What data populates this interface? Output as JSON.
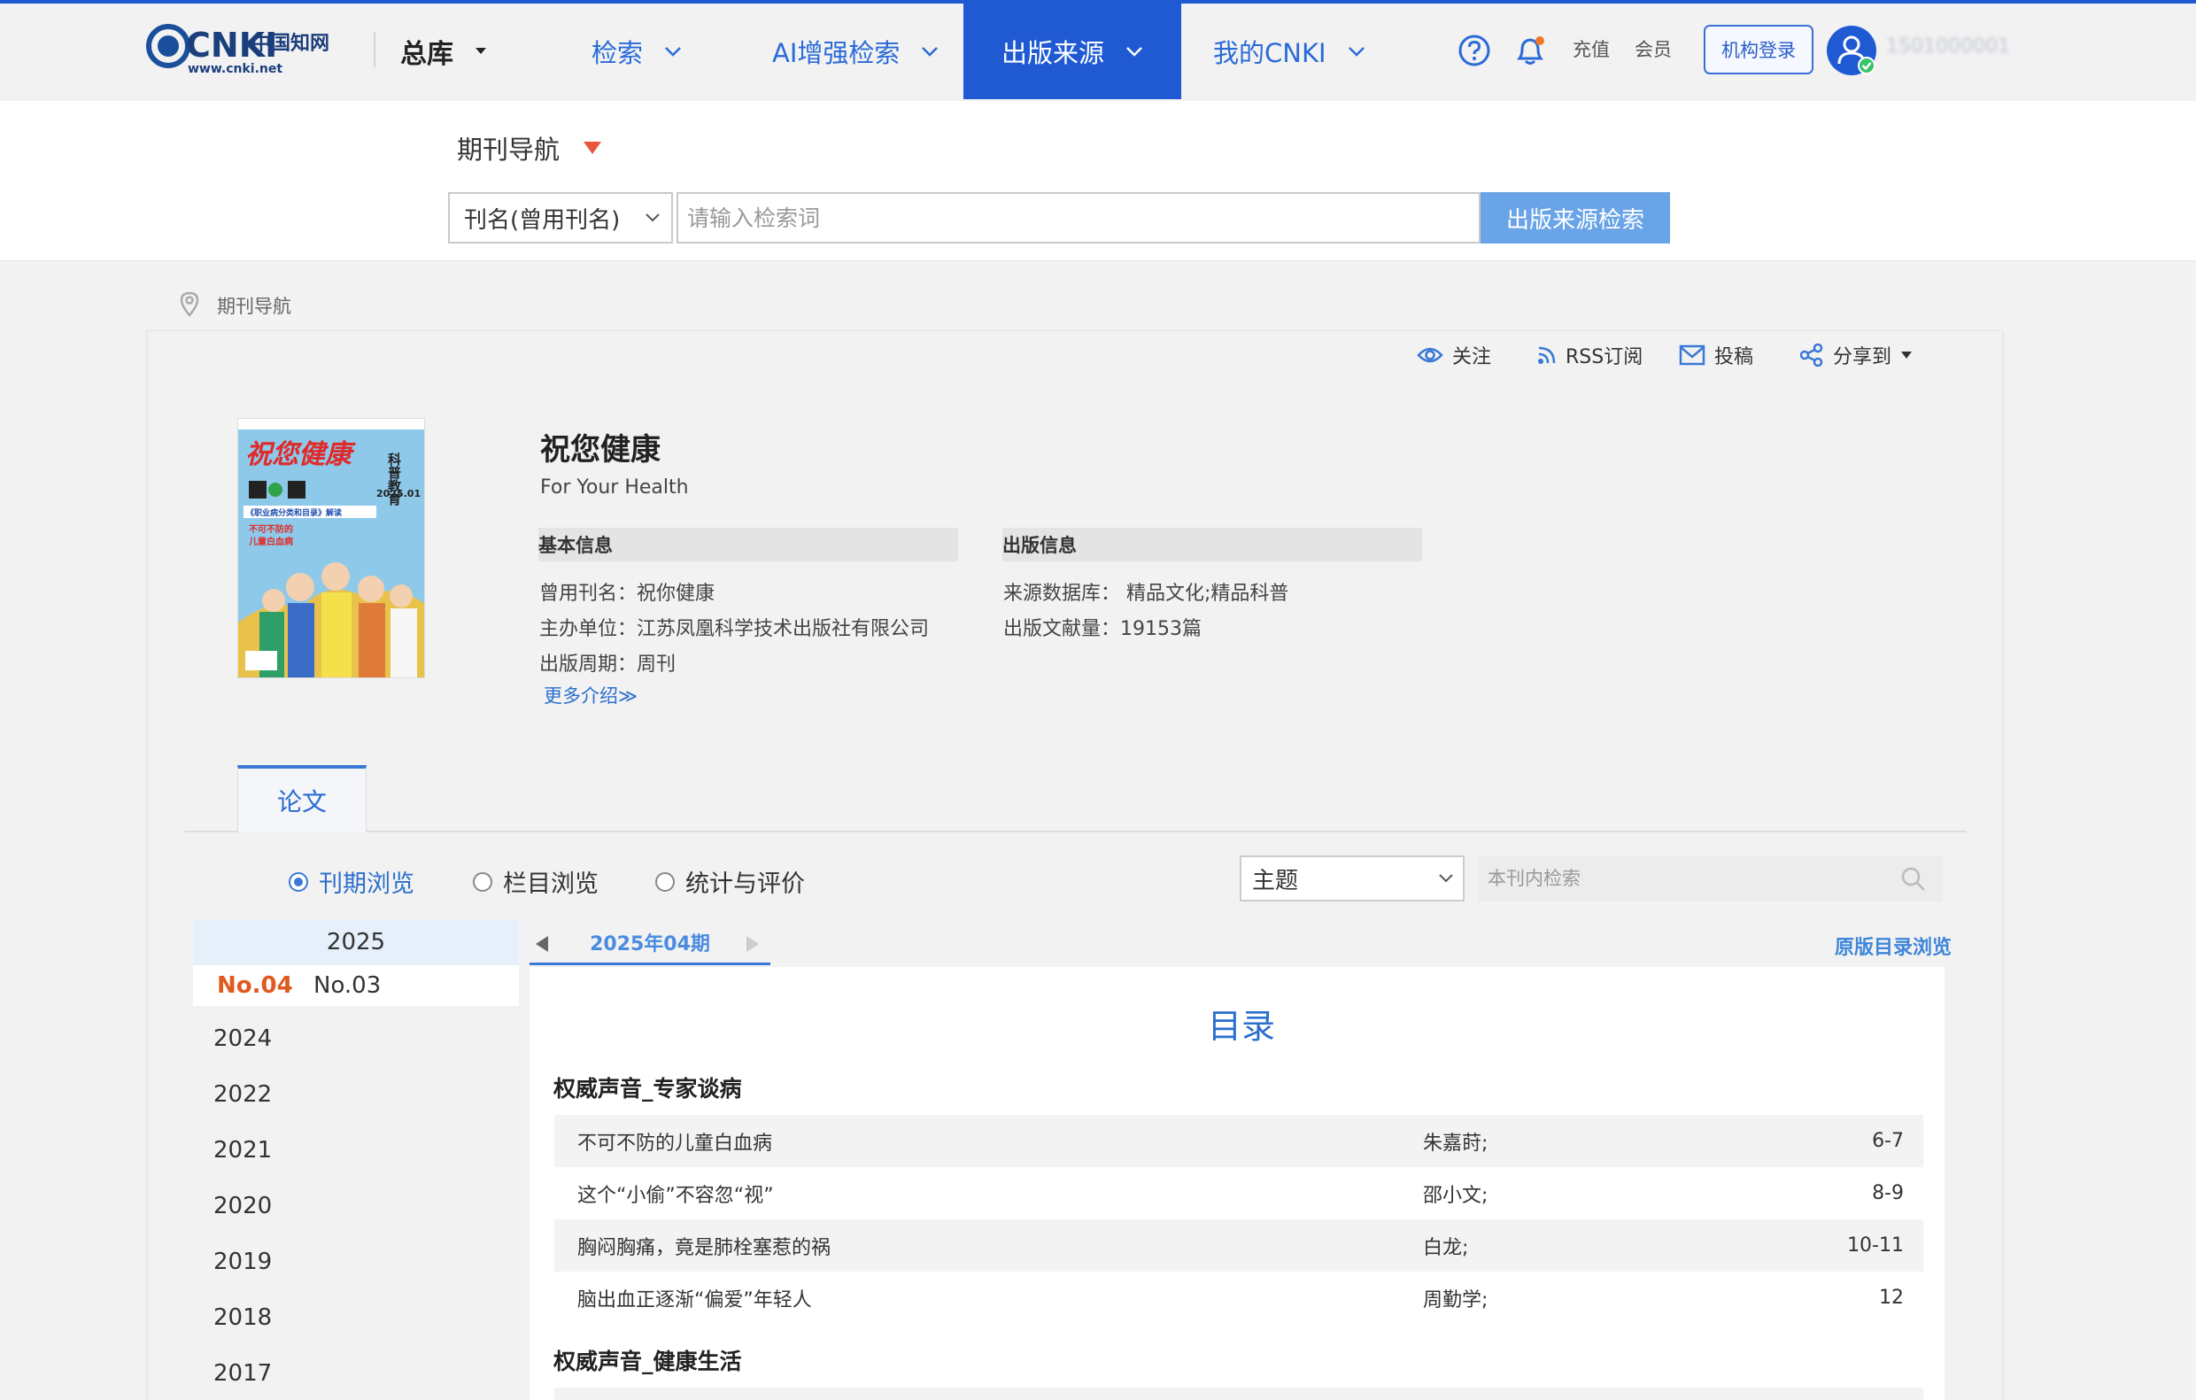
{
  "nav": {
    "zongku": "总库",
    "search": "检索",
    "ai_search": "AI增强检索",
    "pub_source": "出版来源",
    "my_cnki": "我的CNKI",
    "topup": "充值",
    "member": "会员",
    "inst_login": "机构登录",
    "user_name": "1501000001"
  },
  "logo": {
    "main": "CNKI",
    "cn": "中国知网",
    "url": "www.cnki.net"
  },
  "search": {
    "nav_label": "期刊导航",
    "field": "刊名(曾用刊名)",
    "placeholder": "请输入检索词",
    "button": "出版来源检索"
  },
  "breadcrumb": "期刊导航",
  "actions": {
    "follow": "关注",
    "rss": "RSS订阅",
    "submit": "投稿",
    "share": "分享到"
  },
  "cover": {
    "title": "祝您健康",
    "side": "科普教育",
    "issue": "2025.01",
    "line1": "《职业病分类和目录》解读",
    "line2": "不可不防的",
    "line3": "儿童白血病"
  },
  "journal": {
    "title": "祝您健康",
    "en_title": "For Your Health",
    "basic_head": "基本信息",
    "pub_head": "出版信息",
    "former_name": "曾用刊名：祝你健康",
    "sponsor": "主办单位：江苏凤凰科学技术出版社有限公司",
    "cycle": "出版周期：周刊",
    "more": "更多介绍≫",
    "source_db": "来源数据库：  精品文化;精品科普",
    "doc_count": "出版文献量：19153篇"
  },
  "tabs": {
    "papers": "论文"
  },
  "browse": {
    "mode_issue": "刊期浏览",
    "mode_column": "栏目浏览",
    "mode_stats": "统计与评价",
    "scope": "主题",
    "inner_placeholder": "本刊内检索"
  },
  "years": {
    "selected": "2025",
    "issue_current": "No.04",
    "issue_other": "No.03",
    "list": [
      "2024",
      "2022",
      "2021",
      "2020",
      "2019",
      "2018",
      "2017"
    ]
  },
  "issue": {
    "tab": "2025年04期",
    "orig_toc": "原版目录浏览"
  },
  "toc": {
    "title": "目录",
    "col1": "权威声音_专家谈病",
    "col2": "权威声音_健康生活",
    "rows": [
      {
        "title": "不可不防的儿童白血病",
        "author": "朱嘉莳;",
        "pages": "6-7"
      },
      {
        "title": "这个“小偷”不容忽“视”",
        "author": "邵小文;",
        "pages": "8-9"
      },
      {
        "title": "胸闷胸痛，竟是肺栓塞惹的祸",
        "author": "白龙;",
        "pages": "10-11"
      },
      {
        "title": "脑出血正逐渐“偏爱”年轻人",
        "author": "周勤学;",
        "pages": "12"
      }
    ]
  },
  "colors": {
    "brand_blue": "#1f5ad3",
    "link_blue": "#2b6fcc",
    "issue_orange": "#e05a1f"
  }
}
